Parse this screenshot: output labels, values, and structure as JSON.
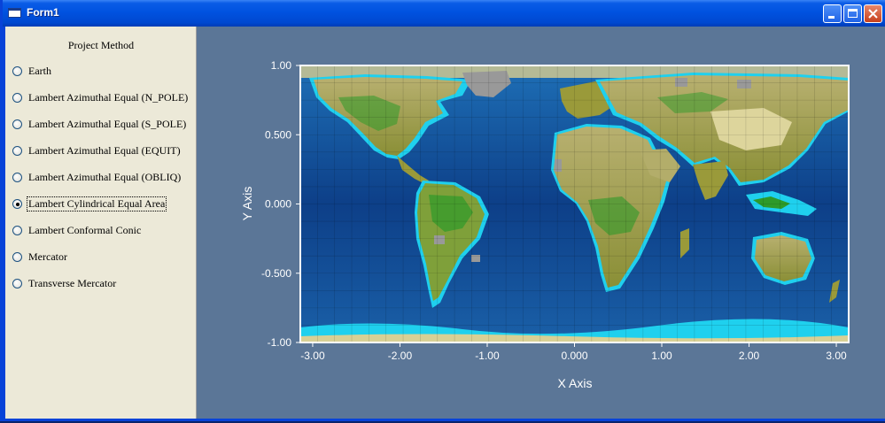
{
  "window": {
    "title": "Form1"
  },
  "panel": {
    "title": "Project Method",
    "options": [
      {
        "label": "Earth",
        "checked": false
      },
      {
        "label": "Lambert Azimuthal Equal (N_POLE)",
        "checked": false
      },
      {
        "label": "Lambert Azimuthal Equal (S_POLE)",
        "checked": false
      },
      {
        "label": "Lambert Azimuthal Equal (EQUIT)",
        "checked": false
      },
      {
        "label": "Lambert Azimuthal Equal (OBLIQ)",
        "checked": false
      },
      {
        "label": "Lambert Cylindrical Equal Area",
        "checked": true
      },
      {
        "label": "Lambert Conformal Conic",
        "checked": false
      },
      {
        "label": "Mercator",
        "checked": false
      },
      {
        "label": "Transverse Mercator",
        "checked": false
      }
    ]
  },
  "plot": {
    "xlabel": "X Axis",
    "ylabel": "Y Axis",
    "xticks": [
      "-3.00",
      "-2.00",
      "-1.00",
      "0.000",
      "1.00",
      "2.00",
      "3.00"
    ],
    "yticks": [
      "1.00",
      "0.500",
      "0.000",
      "-0.500",
      "-1.00"
    ],
    "xrange": [
      -3.1416,
      3.1416
    ],
    "yrange": [
      -1.0,
      1.0
    ],
    "colors": {
      "background": "#5b7697",
      "ocean_deep": "#0b3d86",
      "ocean_mid": "#1b63ad",
      "shelf": "#1fd0ee",
      "land_low": "#2e9a2a",
      "land_mid": "#9a9a3a",
      "land_high": "#ddd59c",
      "ice_gray": "#999999"
    }
  }
}
